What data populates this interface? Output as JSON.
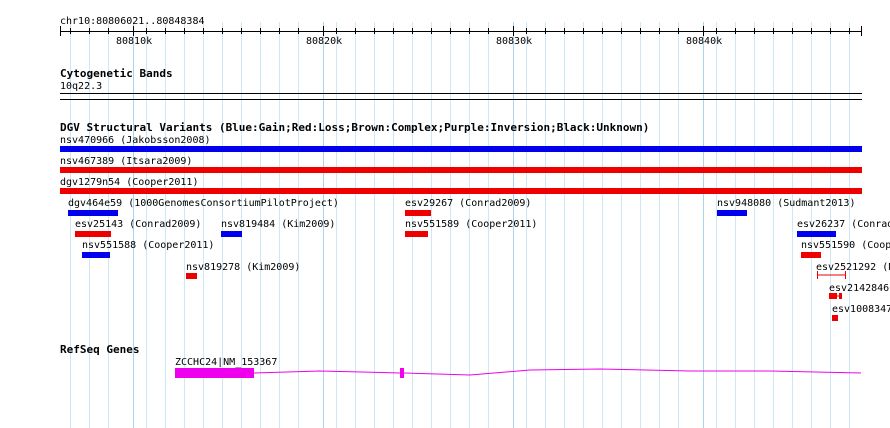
{
  "location": "chr10:80806021..80848384",
  "ruler_ticks": [
    "80810k",
    "80820k",
    "80830k",
    "80840k"
  ],
  "tracks": {
    "cytoband": {
      "title": "Cytogenetic Bands",
      "band": "10q22.3"
    },
    "dgv": {
      "title": "DGV Structural Variants (Blue:Gain;Red:Loss;Brown:Complex;Purple:Inversion;Black:Unknown)",
      "features": [
        {
          "label": "nsv470966 (Jakobsson2008)",
          "color": "#0000ee",
          "type": "gain"
        },
        {
          "label": "nsv467389 (Itsara2009)",
          "color": "#ee0000",
          "type": "loss"
        },
        {
          "label": "dgv1279n54 (Cooper2011)",
          "color": "#ee0000",
          "type": "loss"
        },
        {
          "label": "dgv464e59 (1000GenomesConsortiumPilotProject)",
          "color": "#0000ee",
          "type": "gain"
        },
        {
          "label": "esv29267 (Conrad2009)",
          "color": "#ee0000",
          "type": "loss"
        },
        {
          "label": "nsv948080 (Sudmant2013)",
          "color": "#0000ee",
          "type": "gain"
        },
        {
          "label": "esv25143 (Conrad2009)",
          "color": "#ee0000",
          "type": "loss"
        },
        {
          "label": "nsv819484 (Kim2009)",
          "color": "#0000ee",
          "type": "gain"
        },
        {
          "label": "nsv551589 (Cooper2011)",
          "color": "#ee0000",
          "type": "loss"
        },
        {
          "label": "esv26237 (Conrad",
          "color": "#0000ee",
          "type": "gain"
        },
        {
          "label": "nsv551588 (Cooper2011)",
          "color": "#0000ee",
          "type": "gain"
        },
        {
          "label": "nsv551590 (Coop",
          "color": "#ee0000",
          "type": "loss"
        },
        {
          "label": "nsv819278 (Kim2009)",
          "color": "#ee0000",
          "type": "loss"
        },
        {
          "label": "esv2521292 (N",
          "color": "#ee0000",
          "type": "loss"
        },
        {
          "label": "esv2142846",
          "color": "#ee0000",
          "type": "loss"
        },
        {
          "label": "esv1008347",
          "color": "#ee0000",
          "type": "loss"
        }
      ]
    },
    "refseq": {
      "title": "RefSeq Genes",
      "gene_label": "ZCCHC24|NM_153367",
      "color": "#ee00ee"
    }
  }
}
